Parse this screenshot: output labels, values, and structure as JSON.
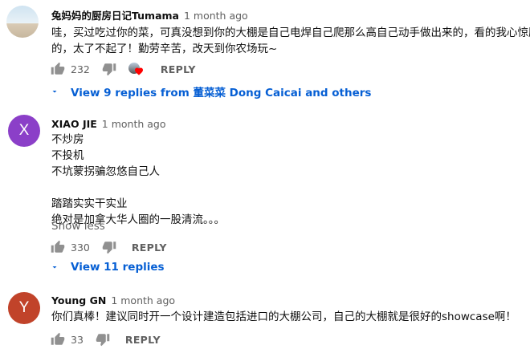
{
  "comments": [
    {
      "author": "兔妈妈的厨房日记Tumama",
      "time": "1 month ago",
      "avatar_letter": "",
      "lines": [
        "哇，买过吃过你的菜，可真没想到你的大棚是自己电焊自己爬那么高自己动手做出来的，看的我心惊胆颤",
        "的，太了不起了！勤劳辛苦，改天到你农场玩~"
      ],
      "likes": "232",
      "reply_label": "REPLY",
      "view_replies": "View 9 replies from 董菜菜 Dong Caicai and others"
    },
    {
      "author": "XIAO JIE",
      "time": "1 month ago",
      "avatar_letter": "X",
      "lines": [
        "不炒房",
        "不投机",
        "不坑蒙拐骗忽悠自己人",
        "",
        "踏踏实实干实业",
        "绝对是加拿大华人圈的一股清流。。。"
      ],
      "show_less": "Show less",
      "likes": "330",
      "reply_label": "REPLY",
      "view_replies": "View 11 replies"
    },
    {
      "author": "Young GN",
      "time": "1 month ago",
      "avatar_letter": "Y",
      "lines": [
        "你们真棒！建议同时开一个设计建造包括进口的大棚公司，自己的大棚就是很好的showcase啊！"
      ],
      "likes": "33",
      "reply_label": "REPLY"
    }
  ],
  "icons": {
    "like": "thumb-up-icon",
    "dislike": "thumb-down-icon",
    "expand": "triangle-down-icon",
    "hearted": "creator-heart-icon"
  },
  "colors": {
    "link_blue": "#065fd4",
    "heart_red": "#ff0000",
    "avatar_x": "#8b3fc8",
    "avatar_y": "#c1432a"
  }
}
